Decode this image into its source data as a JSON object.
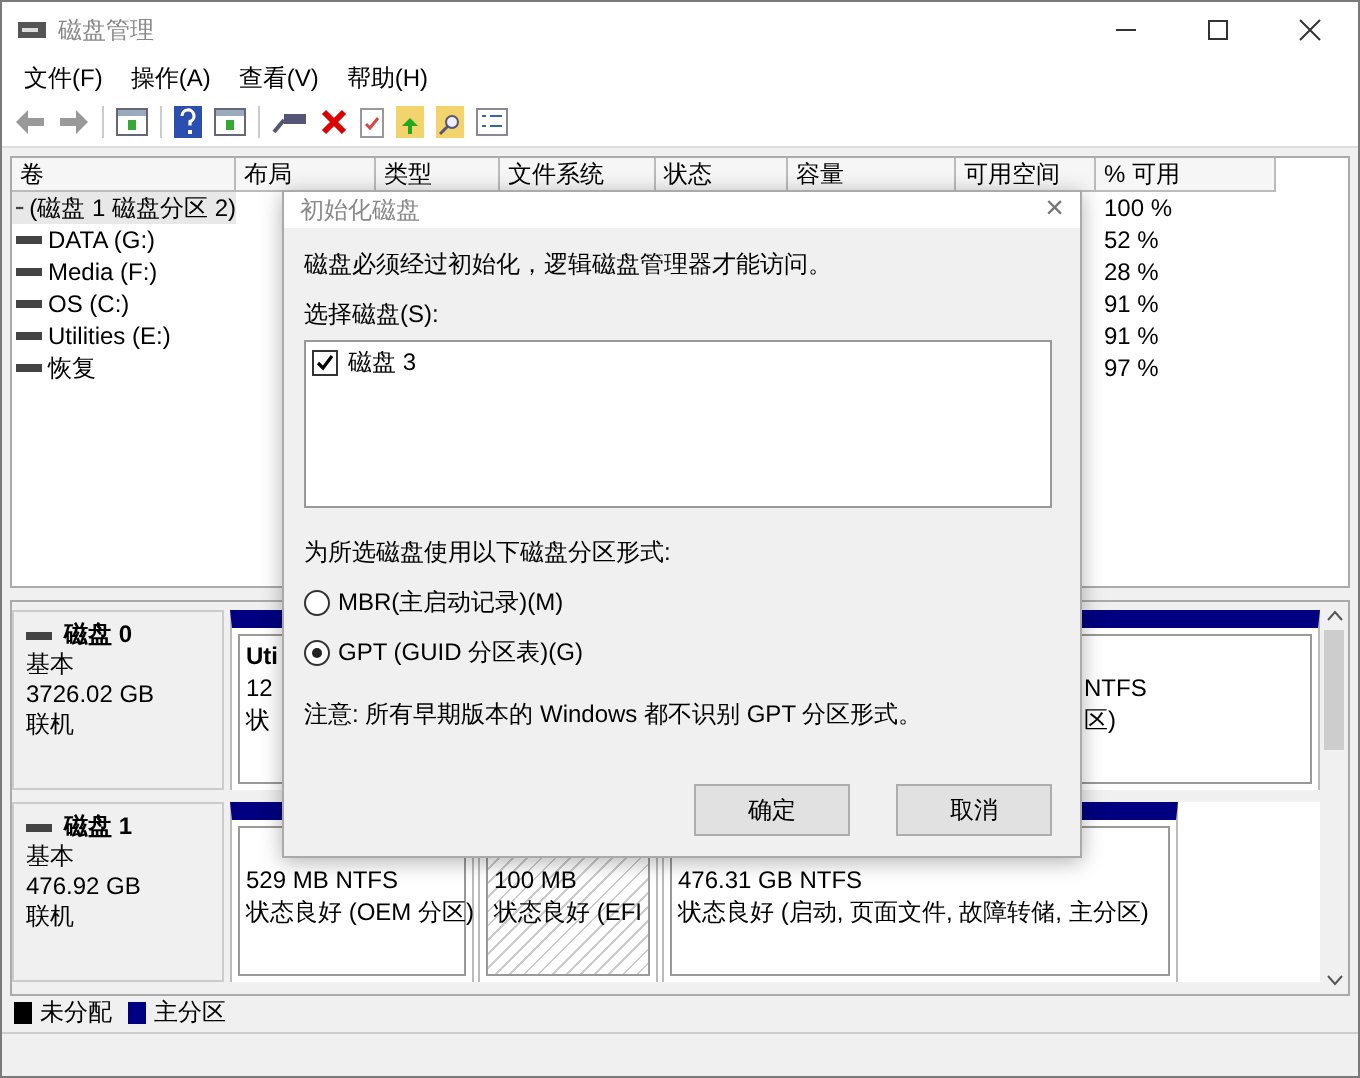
{
  "window": {
    "title": "磁盘管理"
  },
  "menu": [
    "文件(F)",
    "操作(A)",
    "查看(V)",
    "帮助(H)"
  ],
  "volume_table": {
    "columns": [
      "卷",
      "布局",
      "类型",
      "文件系统",
      "状态",
      "容量",
      "可用空间",
      "% 可用"
    ],
    "rows": [
      {
        "volume": "(磁盘 1 磁盘分区 2)",
        "percent_free": "100 %",
        "selected": true
      },
      {
        "volume": "DATA (G:)",
        "percent_free": "52 %",
        "selected": false
      },
      {
        "volume": "Media (F:)",
        "percent_free": "28 %",
        "selected": false
      },
      {
        "volume": "OS (C:)",
        "percent_free": "91 %",
        "selected": false
      },
      {
        "volume": "Utilities (E:)",
        "percent_free": "91 %",
        "selected": false
      },
      {
        "volume": "恢复",
        "percent_free": "97 %",
        "selected": false
      }
    ]
  },
  "disks": [
    {
      "name": "磁盘 0",
      "type": "基本",
      "size": "3726.02 GB",
      "status": "联机",
      "partitions": [
        {
          "kind": "primary",
          "lines": [
            {
              "kind": "name",
              "start": "Uti"
            },
            {
              "kind": "size",
              "start": "12",
              "end": "NTFS"
            },
            {
              "kind": "status",
              "start": "状",
              "end": "区)"
            }
          ]
        }
      ]
    },
    {
      "name": "磁盘 1",
      "type": "基本",
      "size": "476.92 GB",
      "status": "联机",
      "partitions": [
        {
          "kind": "primary",
          "lines": [
            {
              "kind": "size",
              "start": "529 MB NTFS"
            },
            {
              "kind": "status",
              "start": "状态良好 (OEM 分区)"
            }
          ]
        },
        {
          "kind": "efi",
          "lines": [
            {
              "kind": "size",
              "start": "100 MB"
            },
            {
              "kind": "status",
              "start": "状态良好 (EFI"
            }
          ]
        },
        {
          "kind": "primary",
          "lines": [
            {
              "kind": "size",
              "start": "476.31 GB NTFS"
            },
            {
              "kind": "status",
              "start": "状态良好 (启动, 页面文件, 故障转储, 主分区)"
            }
          ]
        }
      ]
    }
  ],
  "legend": [
    {
      "label": "未分配",
      "color": "#000000"
    },
    {
      "label": "主分区",
      "color": "#000080"
    }
  ],
  "dialog": {
    "title": "初始化磁盘",
    "close": "×",
    "message": "磁盘必须经过初始化，逻辑磁盘管理器才能访问。",
    "select_label": "选择磁盘(S):",
    "disk_list": [
      {
        "label": "磁盘 3",
        "checked": true
      }
    ],
    "style_label": "为所选磁盘使用以下磁盘分区形式:",
    "options": [
      {
        "label": "MBR(主启动记录)(M)",
        "selected": false
      },
      {
        "label": "GPT (GUID 分区表)(G)",
        "selected": true
      }
    ],
    "note": "注意: 所有早期版本的 Windows 都不识别 GPT 分区形式。",
    "buttons": [
      "确定",
      "取消"
    ]
  }
}
